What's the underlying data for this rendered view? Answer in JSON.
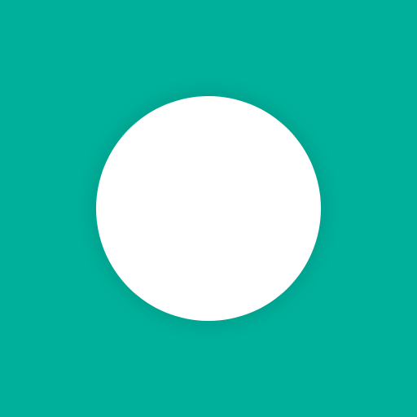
{
  "colors": {
    "background": "#00B09B",
    "circle": "#FFFFFF"
  },
  "icon": "circle-icon"
}
